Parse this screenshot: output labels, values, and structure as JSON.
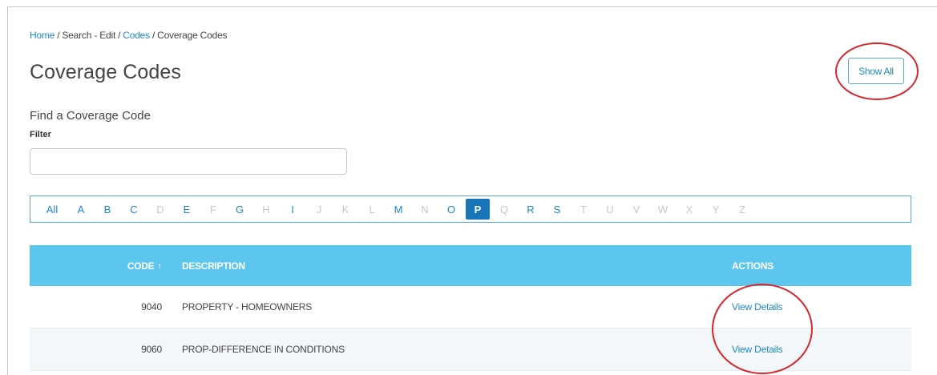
{
  "breadcrumb": {
    "home": "Home",
    "search_edit": "Search - Edit",
    "codes": "Codes",
    "current": "Coverage Codes"
  },
  "page_title": "Coverage Codes",
  "show_all_label": "Show All",
  "find": {
    "title": "Find a Coverage Code",
    "filter_label": "Filter",
    "filter_value": "",
    "filter_placeholder": ""
  },
  "alphabet": {
    "all_label": "All",
    "letters": [
      {
        "letter": "A",
        "state": "on"
      },
      {
        "letter": "B",
        "state": "on"
      },
      {
        "letter": "C",
        "state": "on"
      },
      {
        "letter": "D",
        "state": "off"
      },
      {
        "letter": "E",
        "state": "on"
      },
      {
        "letter": "F",
        "state": "off"
      },
      {
        "letter": "G",
        "state": "on"
      },
      {
        "letter": "H",
        "state": "off"
      },
      {
        "letter": "I",
        "state": "on"
      },
      {
        "letter": "J",
        "state": "off"
      },
      {
        "letter": "K",
        "state": "off"
      },
      {
        "letter": "L",
        "state": "off"
      },
      {
        "letter": "M",
        "state": "on"
      },
      {
        "letter": "N",
        "state": "off"
      },
      {
        "letter": "O",
        "state": "on"
      },
      {
        "letter": "P",
        "state": "active"
      },
      {
        "letter": "Q",
        "state": "off"
      },
      {
        "letter": "R",
        "state": "on"
      },
      {
        "letter": "S",
        "state": "on"
      },
      {
        "letter": "T",
        "state": "off"
      },
      {
        "letter": "U",
        "state": "off"
      },
      {
        "letter": "V",
        "state": "off"
      },
      {
        "letter": "W",
        "state": "off"
      },
      {
        "letter": "X",
        "state": "off"
      },
      {
        "letter": "Y",
        "state": "off"
      },
      {
        "letter": "Z",
        "state": "off"
      }
    ]
  },
  "table": {
    "headers": {
      "code": "CODE",
      "sort_icon": "sort-ascending-arrow-icon",
      "description": "DESCRIPTION",
      "actions": "ACTIONS"
    },
    "rows": [
      {
        "code": "9040",
        "description": "PROPERTY - HOMEOWNERS",
        "action": "View Details"
      },
      {
        "code": "9060",
        "description": "PROP-DIFFERENCE IN CONDITIONS",
        "action": "View Details"
      }
    ]
  },
  "colors": {
    "link": "#1e88c7",
    "header_bg": "#5cc6ee",
    "active_letter_bg": "#1a75b8",
    "annotation": "#d6262a"
  }
}
